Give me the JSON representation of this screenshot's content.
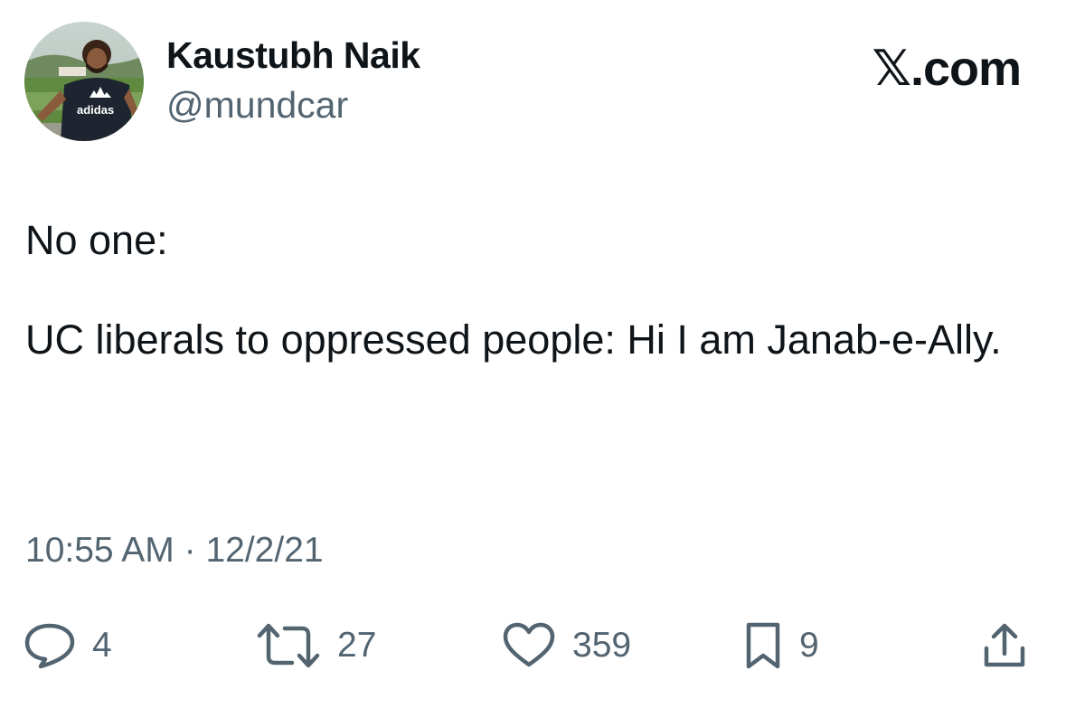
{
  "author": {
    "display_name": "Kaustubh Naik",
    "handle": "@mundcar",
    "avatar_shirt_text": "adidas"
  },
  "site_mark": "𝕏.com",
  "tweet": {
    "line1": "No one:",
    "line2": "UC liberals to oppressed people: Hi I am Janab-e-Ally.",
    "time": "10:55 AM",
    "separator": "·",
    "date": "12/2/21"
  },
  "actions": {
    "replies": "4",
    "reposts": "27",
    "likes": "359",
    "bookmarks": "9"
  },
  "icons": {
    "reply": "reply-icon",
    "repost": "repost-icon",
    "like": "heart-icon",
    "bookmark": "bookmark-icon",
    "share": "share-icon"
  },
  "colors": {
    "text_primary": "#0f1419",
    "text_secondary": "#536471",
    "background": "#ffffff"
  }
}
